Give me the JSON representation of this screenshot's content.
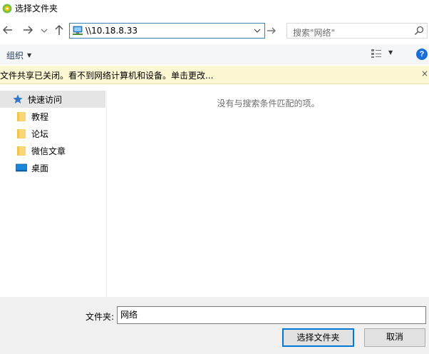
{
  "window": {
    "title": "选择文件夹"
  },
  "nav": {
    "back_icon": "arrow-left-icon",
    "forward_icon": "arrow-right-icon",
    "recent_icon": "chevron-down-icon",
    "up_icon": "arrow-up-icon"
  },
  "address": {
    "value": "\\\\10.18.8.33"
  },
  "search": {
    "placeholder": "搜索\"网络\""
  },
  "toolbar": {
    "organize_label": "组织"
  },
  "infobar": {
    "text": "文件共享已关闭。看不到网络计算机和设备。单击更改...",
    "close_label": "×"
  },
  "sidebar": {
    "items": [
      {
        "label": "快速访问",
        "icon": "star-icon"
      },
      {
        "label": "教程",
        "icon": "folder-icon"
      },
      {
        "label": "论坛",
        "icon": "folder-icon"
      },
      {
        "label": "微信文章",
        "icon": "folder-icon"
      },
      {
        "label": "桌面",
        "icon": "desktop-icon"
      }
    ]
  },
  "content": {
    "empty_message": "没有与搜索条件匹配的项。"
  },
  "footer": {
    "folder_label": "文件夹:",
    "folder_value": "网络",
    "select_button": "选择文件夹",
    "cancel_button": "取消"
  },
  "colors": {
    "accent": "#0078d7",
    "infobar_bg": "#fbf7d3",
    "help": "#1a6ed8"
  }
}
